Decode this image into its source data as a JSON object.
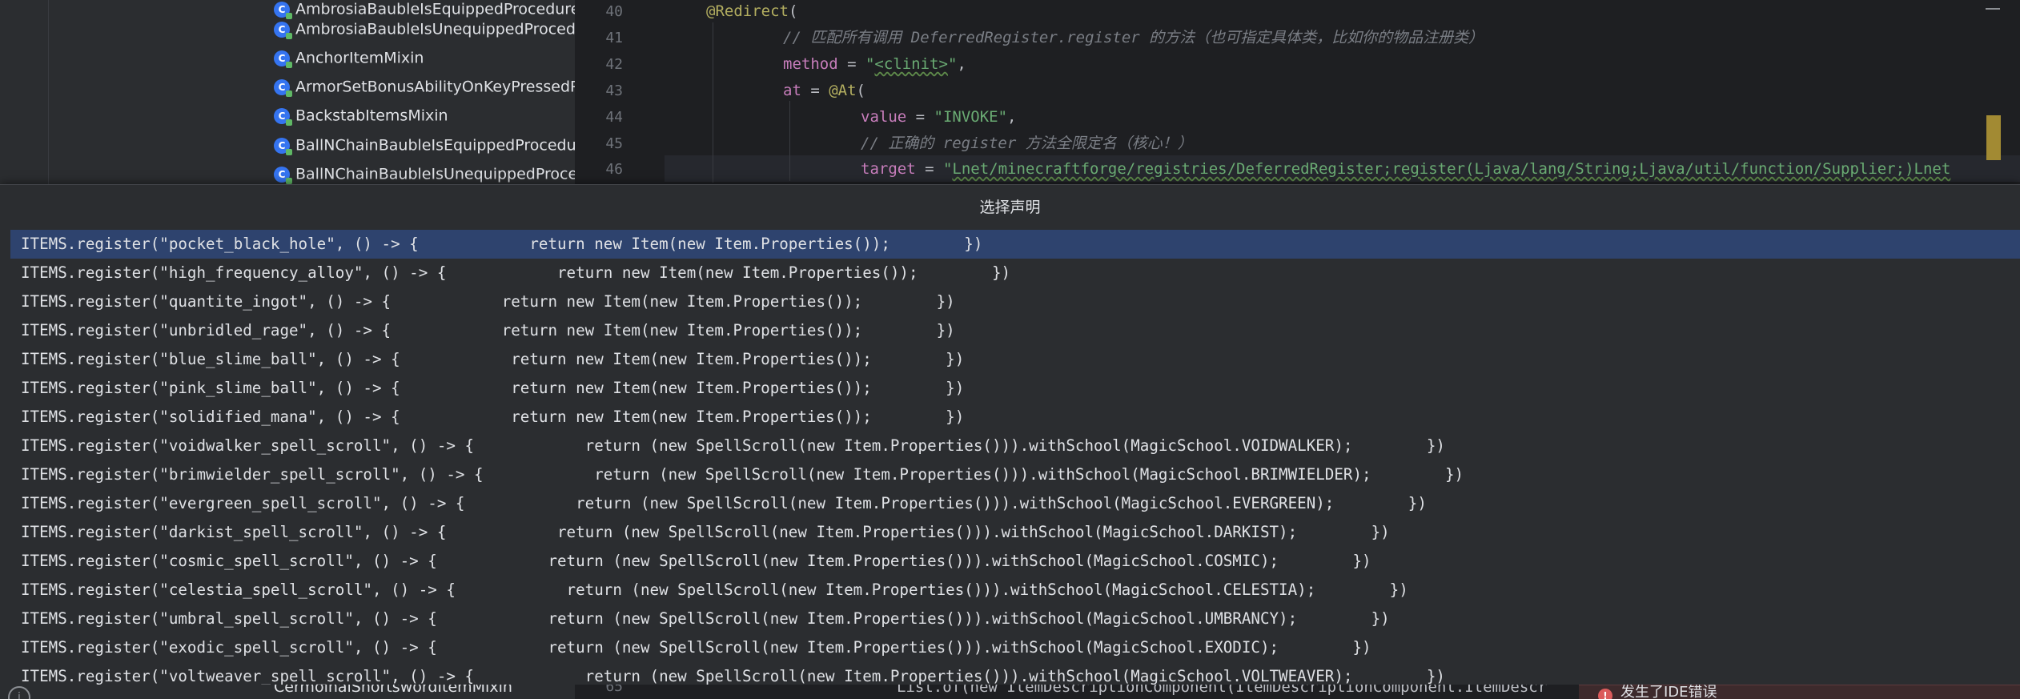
{
  "colors": {
    "selection": "#2e436e",
    "popup_background": "#2b2d30",
    "editor_background": "#1e1f22",
    "annotation": "#b3ae60",
    "string": "#6aab73",
    "comment": "#7a7e85",
    "class_icon": "#3574f0",
    "error": "#db5c5c"
  },
  "project_tree": {
    "items": [
      {
        "label": "AmbrosiaBaubleIsEquippedProcedureMi",
        "icon": "class-icon"
      },
      {
        "label": "AmbrosiaBaubleIsUnequippedProcedure",
        "icon": "class-icon"
      },
      {
        "label": "AnchorItemMixin",
        "icon": "class-icon"
      },
      {
        "label": "ArmorSetBonusAbilityOnKeyPressedProc",
        "icon": "class-icon"
      },
      {
        "label": "BackstabItemsMixin",
        "icon": "class-icon"
      },
      {
        "label": "BallNChainBaubleIsEquippedProcedureM",
        "icon": "class-icon"
      },
      {
        "label": "BallNChainBaubleIsUnequippedProcedur",
        "icon": "class-icon"
      }
    ],
    "bottom_item": "CermoinalShortswordItemMixin"
  },
  "editor": {
    "lines": [
      {
        "num": "40"
      },
      {
        "num": "41",
        "comment": "// 匹配所有调用 DeferredRegister.register 的方法（也可指定具体类，比如你的物品注册类）"
      },
      {
        "num": "42",
        "key": "method",
        "eq": " = ",
        "q1": "\"",
        "str": "<clinit>",
        "q2": "\"",
        "end": ","
      },
      {
        "num": "43",
        "key": "at",
        "eq": " = ",
        "ann": "@At",
        "end": "("
      },
      {
        "num": "44",
        "key": "value",
        "eq": " = ",
        "str": "\"INVOKE\"",
        "end": ","
      },
      {
        "num": "45",
        "comment": "// 正确的 register 方法全限定名（核心！）"
      },
      {
        "num": "46",
        "key": "target",
        "eq": " = ",
        "q1": "\"",
        "str": "Lnet/minecraftforge/registries/DeferredRegister;register(Ljava/lang/String;Ljava/util/function/Supplier;)Lnet"
      }
    ],
    "line40_annotation": "@Redirect",
    "line40_paren": "(",
    "bottom_line_num": "65",
    "bottom_code": "List.of(new ItemDescriptionComponent(ItemDescriptionComponent.ItemDescr"
  },
  "popup": {
    "title": "选择声明",
    "selected_index": 0,
    "items": [
      "ITEMS.register(\"pocket_black_hole\", () -> {            return new Item(new Item.Properties());        })",
      "ITEMS.register(\"high_frequency_alloy\", () -> {            return new Item(new Item.Properties());        })",
      "ITEMS.register(\"quantite_ingot\", () -> {            return new Item(new Item.Properties());        })",
      "ITEMS.register(\"unbridled_rage\", () -> {            return new Item(new Item.Properties());        })",
      "ITEMS.register(\"blue_slime_ball\", () -> {            return new Item(new Item.Properties());        })",
      "ITEMS.register(\"pink_slime_ball\", () -> {            return new Item(new Item.Properties());        })",
      "ITEMS.register(\"solidified_mana\", () -> {            return new Item(new Item.Properties());        })",
      "ITEMS.register(\"voidwalker_spell_scroll\", () -> {            return (new SpellScroll(new Item.Properties())).withSchool(MagicSchool.VOIDWALKER);        })",
      "ITEMS.register(\"brimwielder_spell_scroll\", () -> {            return (new SpellScroll(new Item.Properties())).withSchool(MagicSchool.BRIMWIELDER);        })",
      "ITEMS.register(\"evergreen_spell_scroll\", () -> {            return (new SpellScroll(new Item.Properties())).withSchool(MagicSchool.EVERGREEN);        })",
      "ITEMS.register(\"darkist_spell_scroll\", () -> {            return (new SpellScroll(new Item.Properties())).withSchool(MagicSchool.DARKIST);        })",
      "ITEMS.register(\"cosmic_spell_scroll\", () -> {            return (new SpellScroll(new Item.Properties())).withSchool(MagicSchool.COSMIC);        })",
      "ITEMS.register(\"celestia_spell_scroll\", () -> {            return (new SpellScroll(new Item.Properties())).withSchool(MagicSchool.CELESTIA);        })",
      "ITEMS.register(\"umbral_spell_scroll\", () -> {            return (new SpellScroll(new Item.Properties())).withSchool(MagicSchool.UMBRANCY);        })",
      "ITEMS.register(\"exodic_spell_scroll\", () -> {            return (new SpellScroll(new Item.Properties())).withSchool(MagicSchool.EXODIC);        })",
      "ITEMS.register(\"voltweaver_spell_scroll\", () -> {            return (new SpellScroll(new Item.Properties())).withSchool(MagicSchool.VOLTWEAVER);        })"
    ]
  },
  "notification": {
    "icon": "error-icon",
    "message": "发生了IDE错误"
  }
}
